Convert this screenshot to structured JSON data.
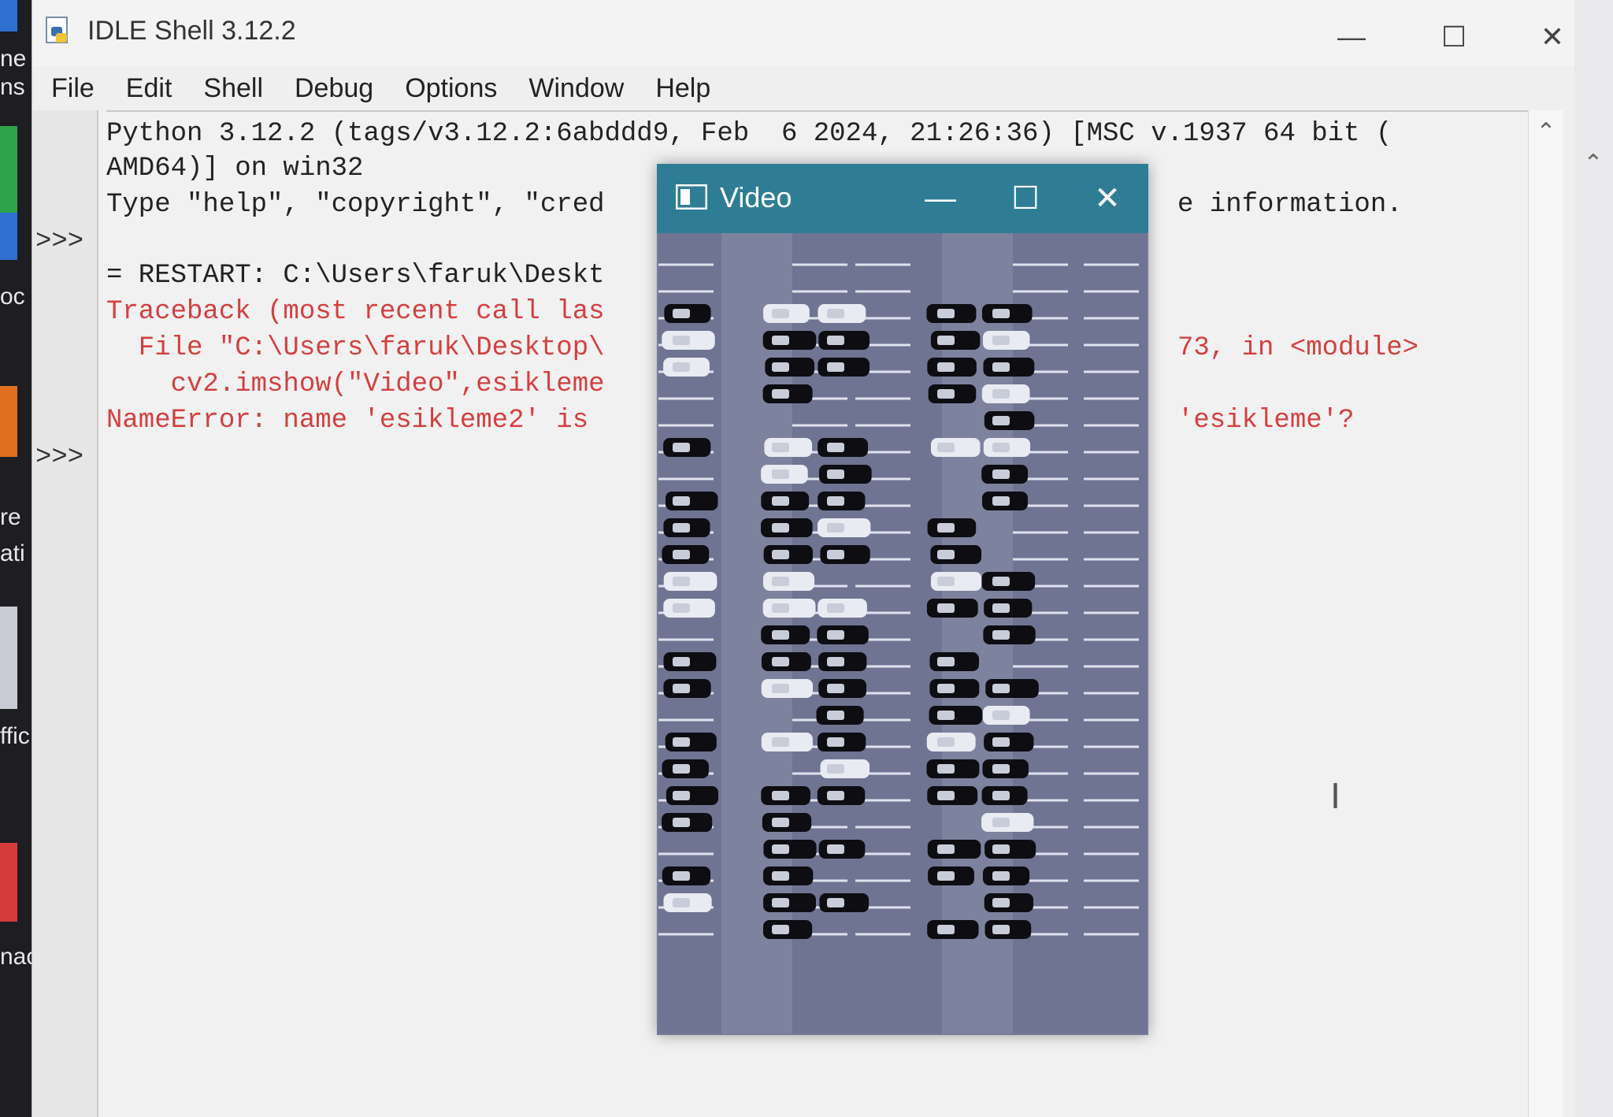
{
  "desktop": {
    "fragments": [
      "ne",
      "ns",
      "oc",
      "re",
      "ati",
      "ffic",
      "nac"
    ]
  },
  "window": {
    "title": "IDLE Shell 3.12.2",
    "controls": {
      "minimize": "—",
      "maximize": "☐",
      "close": "✕"
    }
  },
  "menu": {
    "items": [
      "File",
      "Edit",
      "Shell",
      "Debug",
      "Options",
      "Window",
      "Help"
    ]
  },
  "shell": {
    "prompts": [
      ">>>",
      ">>>"
    ],
    "lines": [
      "Python 3.12.2 (tags/v3.12.2:6abddd9, Feb  6 2024, 21:26:36) [MSC v.1937 64 bit (",
      "AMD64)] on win32",
      "Type \"help\", \"copyright\", \"cred",
      "= RESTART: C:\\Users\\faruk\\Deskt",
      "Traceback (most recent call las",
      "  File \"C:\\Users\\faruk\\Desktop\\",
      "    cv2.imshow(\"Video\",esikleme",
      "NameError: name 'esikleme2' is"
    ],
    "right_fragments": [
      "e information.",
      "73, in <module>",
      "'esikleme'?"
    ],
    "cursor_glyph": "I"
  },
  "video_window": {
    "title": "Video",
    "controls": {
      "minimize": "—",
      "maximize": "☐",
      "close": "✕"
    }
  },
  "colors": {
    "error_text": "#d43f3f",
    "video_titlebar": "#2f7d95"
  }
}
